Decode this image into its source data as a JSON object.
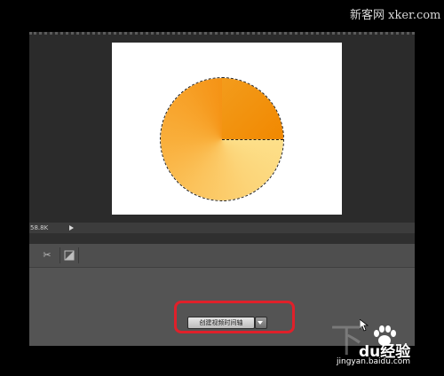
{
  "status_bar": {
    "doc_size": "58.8K"
  },
  "timeline": {
    "tools": {
      "split_icon": "scissors-icon",
      "transition_icon": "transition-icon"
    },
    "create_button_label": "创建视频时间轴",
    "dropdown_icon": "chevron-down-icon"
  },
  "colors": {
    "highlight": "#e0202a",
    "pie_light": "#fde08a",
    "pie_dark": "#f18800"
  },
  "watermarks": {
    "top": "新客网 xker.com",
    "logo": "du经验",
    "site": "jingyan.baidu.com"
  }
}
